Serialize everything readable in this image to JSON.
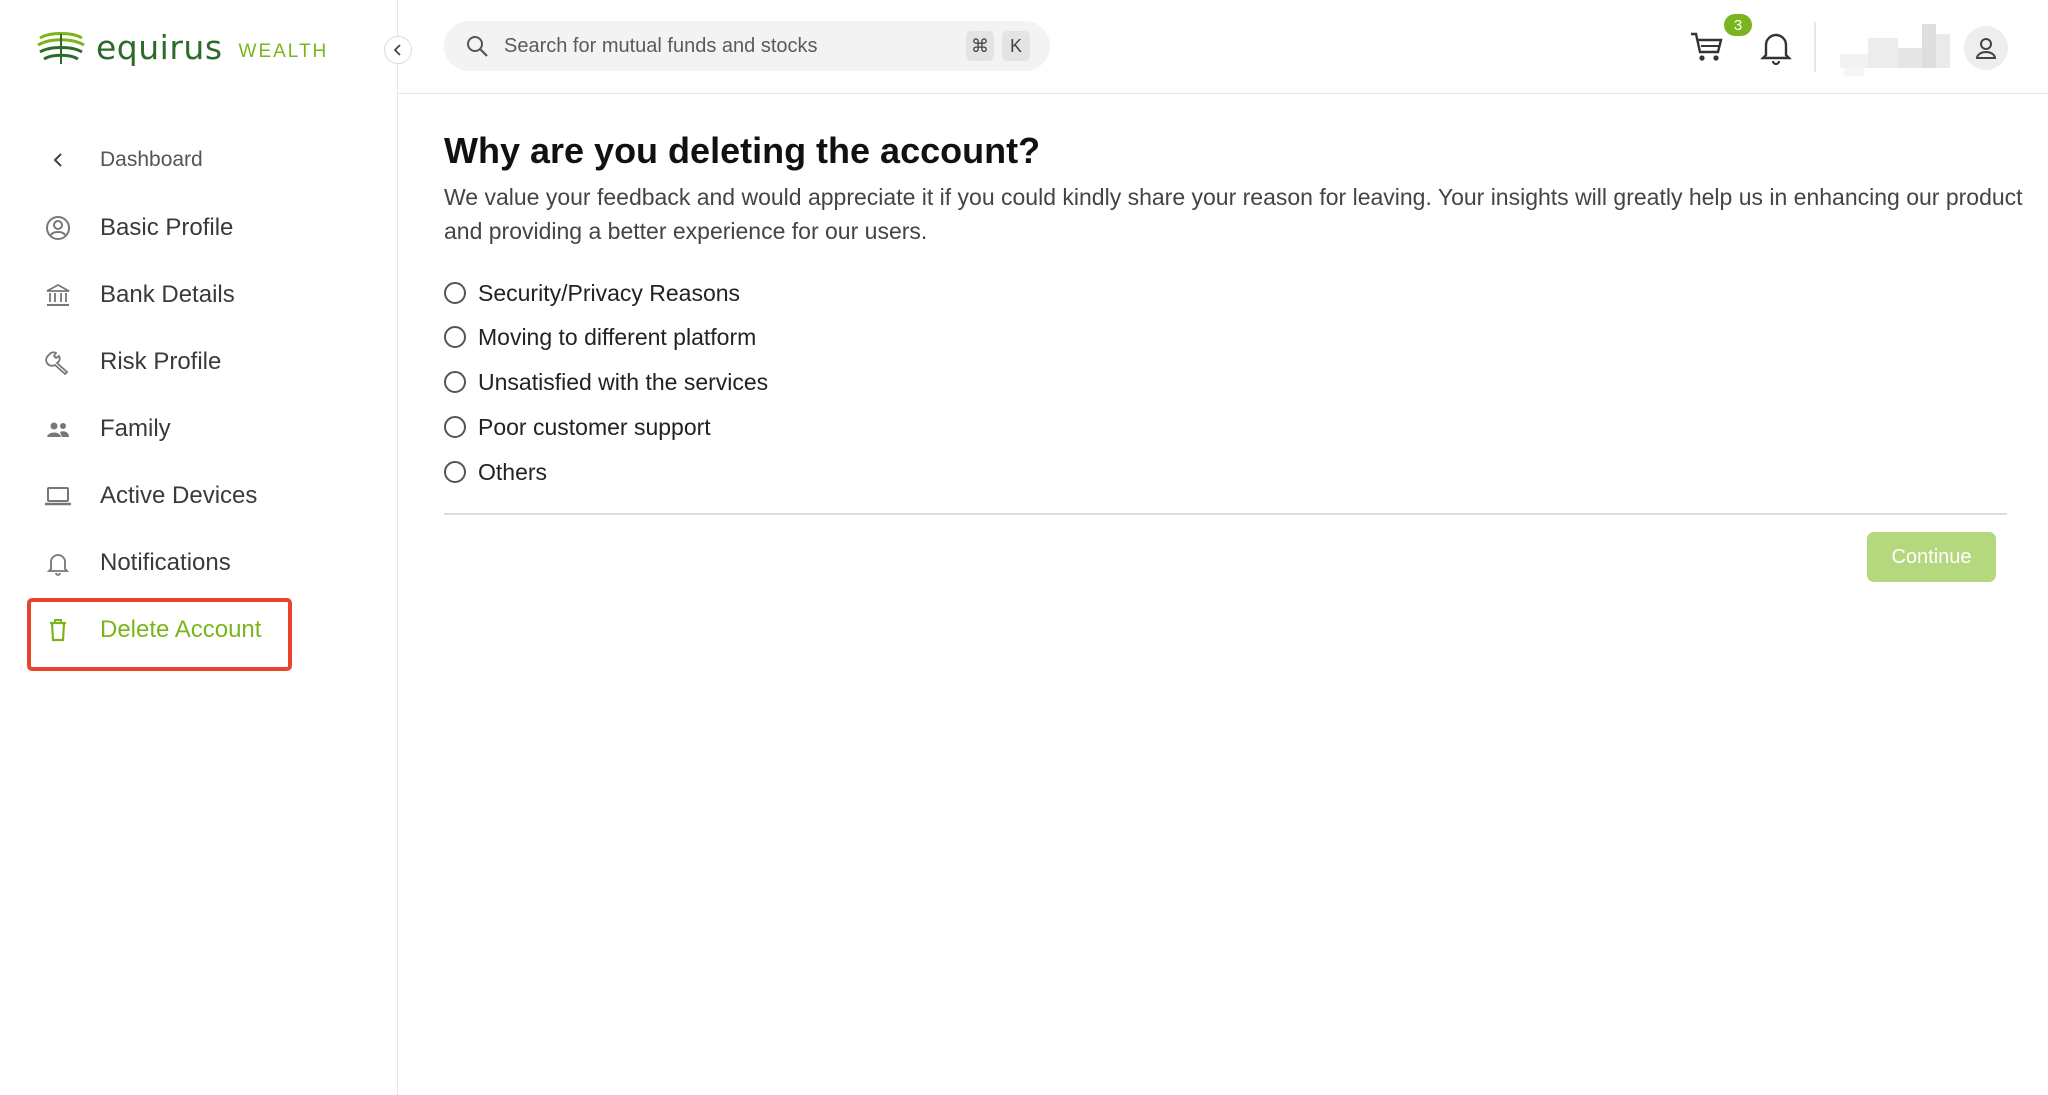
{
  "brand": {
    "name": "equirus",
    "sub": "WEALTH"
  },
  "sidebar": {
    "back_label": "Dashboard",
    "items": [
      {
        "label": "Basic Profile",
        "icon": "user-circle-icon"
      },
      {
        "label": "Bank Details",
        "icon": "bank-icon"
      },
      {
        "label": "Risk Profile",
        "icon": "wrench-icon"
      },
      {
        "label": "Family",
        "icon": "family-icon"
      },
      {
        "label": "Active Devices",
        "icon": "laptop-icon"
      },
      {
        "label": "Notifications",
        "icon": "bell-icon"
      },
      {
        "label": "Delete Account",
        "icon": "trash-icon",
        "active": true
      }
    ]
  },
  "topbar": {
    "search_placeholder": "Search for mutual funds and stocks",
    "shortcut_keys": [
      "⌘",
      "K"
    ],
    "cart_count": "3"
  },
  "main": {
    "title": "Why are you deleting the account?",
    "description": "We value your feedback and would appreciate it if you could kindly share your reason for leaving. Your insights will greatly help us in enhancing our product and providing a better experience for our users.",
    "options": [
      "Security/Privacy Reasons",
      "Moving to different platform",
      "Unsatisfied with the services",
      "Poor customer support",
      "Others"
    ],
    "continue_label": "Continue"
  },
  "colors": {
    "accent": "#7ab51d",
    "brand_dark": "#2e6b2a",
    "highlight": "#e8452c",
    "button_disabled": "#b5d87f"
  }
}
